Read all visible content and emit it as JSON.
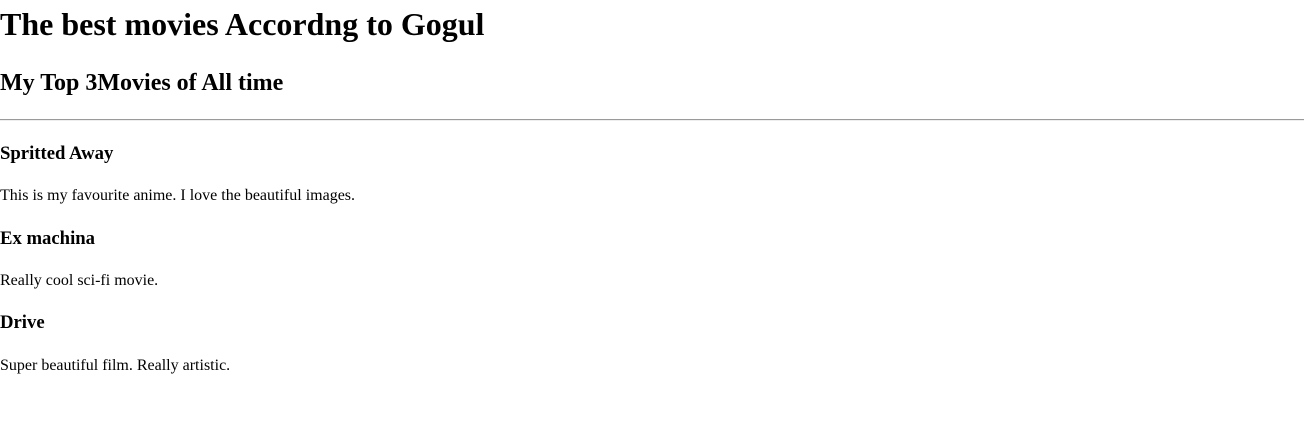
{
  "page": {
    "title": "The best movies Accordng to Gogul",
    "subtitle": "My Top 3Movies of All time"
  },
  "movies": [
    {
      "title": "Spritted Away",
      "description": "This is my favourite anime. I love the beautiful images."
    },
    {
      "title": "Ex machina",
      "description": "Really cool sci-fi movie."
    },
    {
      "title": "Drive",
      "description": "Super beautiful film. Really artistic."
    }
  ]
}
